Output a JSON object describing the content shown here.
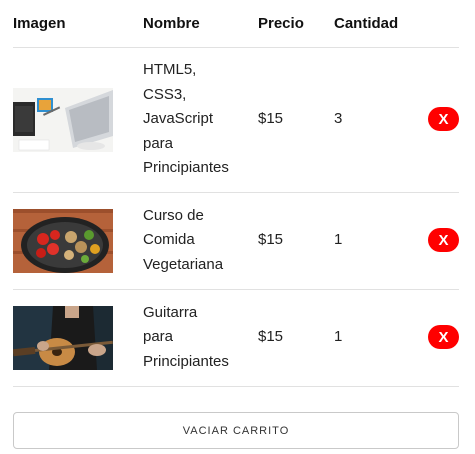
{
  "table": {
    "headers": [
      "Imagen",
      "Nombre",
      "Precio",
      "Cantidad"
    ]
  },
  "items": [
    {
      "image_icon": "laptop-desk-photo",
      "name_lines": [
        "HTML5,",
        "CSS3,",
        "JavaScript",
        "para",
        "Principiantes"
      ],
      "price": "$15",
      "quantity": "3",
      "delete_label": "X"
    },
    {
      "image_icon": "vegetables-pan-photo",
      "name_lines": [
        "Curso de",
        "Comida",
        "Vegetariana"
      ],
      "price": "$15",
      "quantity": "1",
      "delete_label": "X"
    },
    {
      "image_icon": "guitar-player-photo",
      "name_lines": [
        "Guitarra",
        "para",
        "Principiantes"
      ],
      "price": "$15",
      "quantity": "1",
      "delete_label": "X"
    }
  ],
  "empty_cart_label": "VACIAR CARRITO",
  "colors": {
    "delete_button": "#ff0000",
    "border": "#e1e1e1"
  }
}
